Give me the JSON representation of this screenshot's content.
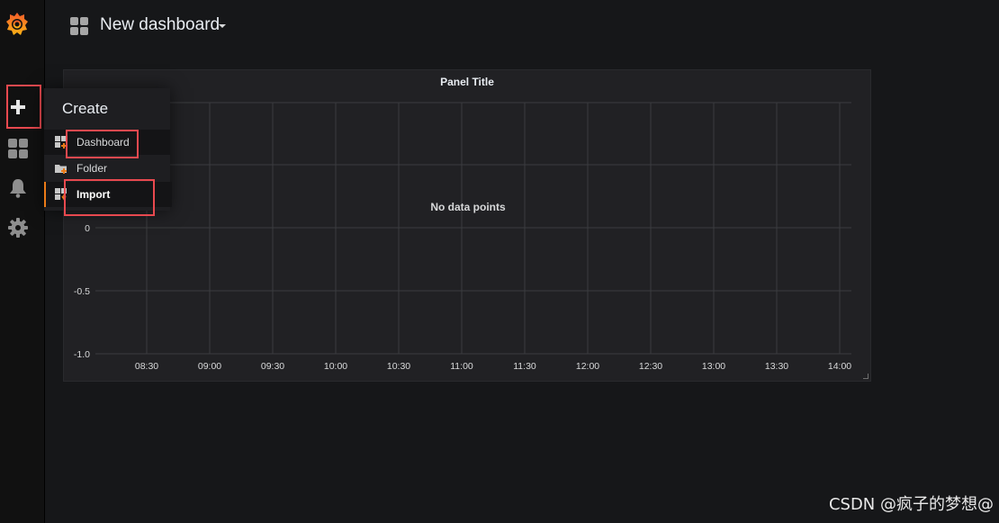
{
  "topbar": {
    "dashboard_title": "New dashboard"
  },
  "panel": {
    "title": "Panel Title",
    "no_data": "No data points",
    "y_ticks": [
      "0",
      "-0.5",
      "-1.0"
    ],
    "x_ticks": [
      "08:30",
      "09:00",
      "09:30",
      "10:00",
      "10:30",
      "11:00",
      "11:30",
      "12:00",
      "12:30",
      "13:00",
      "13:30",
      "14:00"
    ]
  },
  "create_menu": {
    "header": "Create",
    "items": [
      {
        "label": "Dashboard",
        "icon": "dashboard-add-icon"
      },
      {
        "label": "Folder",
        "icon": "folder-add-icon"
      },
      {
        "label": "Import",
        "icon": "import-icon"
      }
    ]
  },
  "sidebar": {
    "items": [
      {
        "icon": "plus-icon"
      },
      {
        "icon": "dashboards-grid-icon"
      },
      {
        "icon": "bell-icon"
      },
      {
        "icon": "gear-icon"
      }
    ]
  },
  "colors": {
    "accent_orange": "#eb7b18",
    "highlight_red": "#e8494f",
    "background": "#161719"
  },
  "watermark": "CSDN @疯子的梦想@"
}
